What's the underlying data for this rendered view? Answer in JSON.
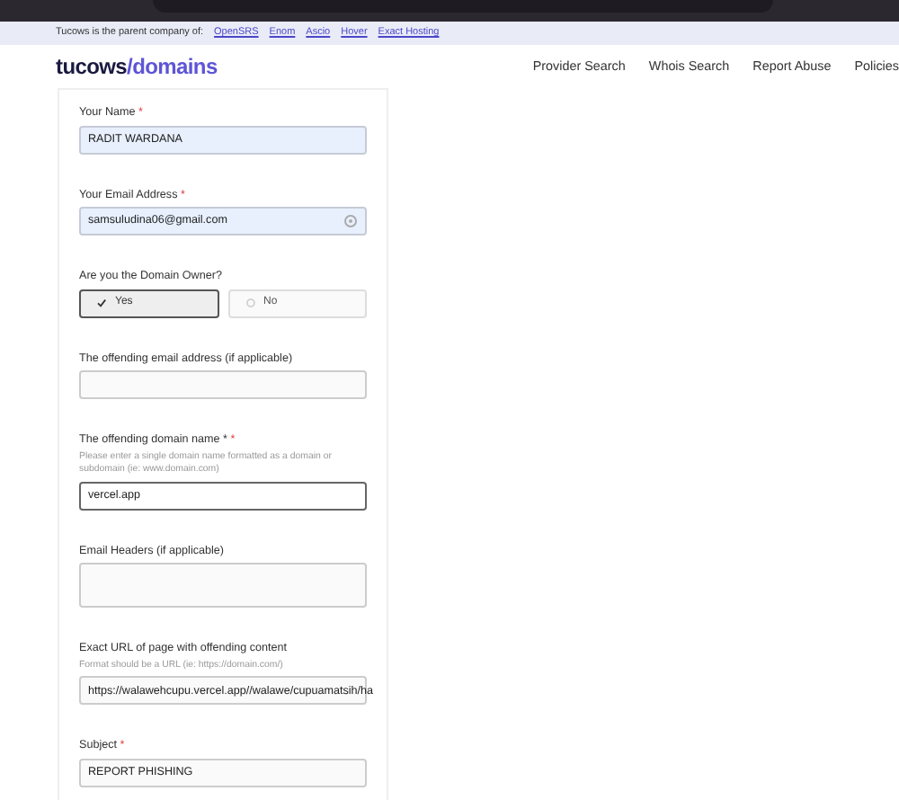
{
  "parent_bar": {
    "text": "Tucows is the parent company of:",
    "links": [
      "OpenSRS",
      "Enom",
      "Ascio",
      "Hover",
      "Exact Hosting"
    ]
  },
  "logo": {
    "brand": "tucows",
    "product": "/domains"
  },
  "nav": [
    "Provider Search",
    "Whois Search",
    "Report Abuse",
    "Policies"
  ],
  "form": [
    {
      "kind": "text",
      "label": "Your Name",
      "required_mark": "*",
      "value": "RADIT WARDANA",
      "autofilled": true,
      "focused": false
    },
    {
      "kind": "text",
      "label": "Your Email Address",
      "required_mark": "*",
      "value": "samsuludina06@gmail.com",
      "autofilled": true,
      "focused": false,
      "key_icon": true
    },
    {
      "kind": "choice",
      "label": "Are you the Domain Owner?",
      "options": [
        {
          "label": "Yes",
          "selected": true
        },
        {
          "label": "No",
          "selected": false
        }
      ]
    },
    {
      "kind": "text",
      "label": "The offending email address (if applicable)",
      "autofilled": false,
      "focused": false
    },
    {
      "kind": "text",
      "label": "The offending domain name *",
      "required_mark": "*",
      "hint": "Please enter a single domain name formatted as a domain or subdomain (ie: www.domain.com)",
      "value": "vercel.app",
      "autofilled": false,
      "focused": true
    },
    {
      "kind": "textarea",
      "label": "Email Headers (if applicable)"
    },
    {
      "kind": "text",
      "label": "Exact URL of page with offending content",
      "hint": "Format should be a URL (ie: https://domain.com/)",
      "value": "https://walawehcupu.vercel.app//walawe/cupuamatsih/ha",
      "autofilled": false,
      "focused": false
    },
    {
      "kind": "text",
      "label": "Subject",
      "required_mark": "*",
      "value": "REPORT PHISHING",
      "autofilled": false,
      "focused": false
    }
  ]
}
